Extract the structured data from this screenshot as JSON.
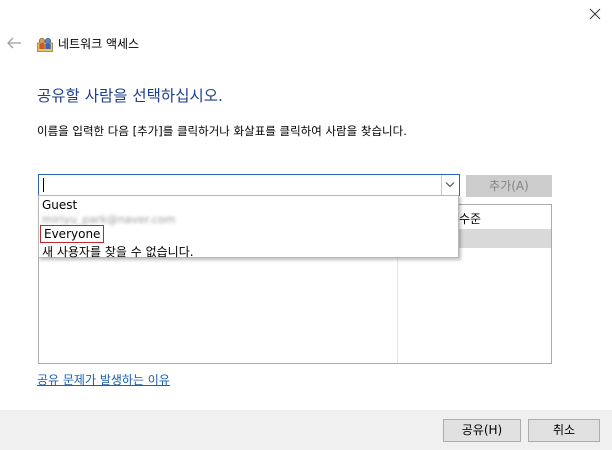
{
  "window": {
    "title": "네트워크 액세스",
    "close_icon": "close-icon",
    "back_icon": "back-arrow-icon",
    "title_icon": "network-users-icon"
  },
  "main": {
    "heading": "공유할 사람을 선택하십시오.",
    "instruction": "이름을 입력한 다음 [추가]를 클릭하거나 화살표를 클릭하여 사람을 찾습니다.",
    "name_input_value": "",
    "add_button": "추가(A)",
    "table": {
      "column_permission": "수준"
    },
    "help_link": "공유 문제가 발생하는 이유"
  },
  "dropdown": {
    "items": [
      "Guest",
      "Everyone",
      "새 사용자를 찾을 수 없습니다."
    ],
    "blurred_email": "miriyu_park@naver.com"
  },
  "footer": {
    "share_button": "공유(H)",
    "cancel_button": "취소"
  },
  "colors": {
    "heading": "#1e3f8f",
    "link": "#1a5fb4",
    "focus_border": "#2a63b8",
    "highlight_box": "#c1282d"
  }
}
